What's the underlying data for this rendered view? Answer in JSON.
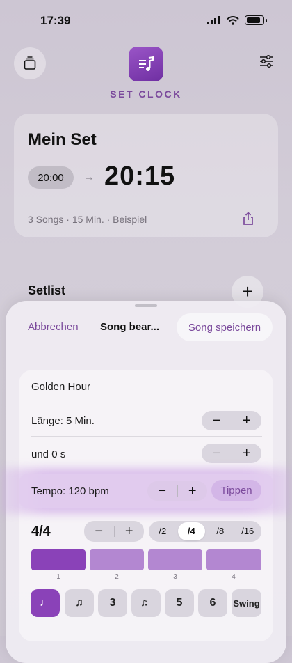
{
  "status": {
    "time": "17:39"
  },
  "header": {
    "title": "SET CLOCK"
  },
  "set": {
    "name": "Mein Set",
    "start": "20:00",
    "end": "20:15",
    "meta": "3 Songs · 15 Min. · Beispiel"
  },
  "setlist": {
    "title": "Setlist"
  },
  "sheet": {
    "cancel": "Abbrechen",
    "title": "Song bear...",
    "save": "Song speichern",
    "song_name": "Golden Hour",
    "length_label": "Länge: 5 Min.",
    "seconds_label": "und 0 s",
    "tempo_label": "Tempo: 120 bpm",
    "tap": "Tippen",
    "signature": "4/4",
    "denominators": [
      "/2",
      "/4",
      "/8",
      "/16"
    ],
    "selected_denominator": "/4",
    "beats": [
      "1",
      "2",
      "3",
      "4"
    ],
    "subdivisions": [
      "♩",
      "♫",
      "3",
      "♬",
      "5",
      "6",
      "Swing"
    ],
    "stepper": {
      "minus": "−",
      "plus": "+"
    }
  },
  "colors": {
    "accent": "#8a42b8",
    "accent_text": "#7b4a9c"
  }
}
